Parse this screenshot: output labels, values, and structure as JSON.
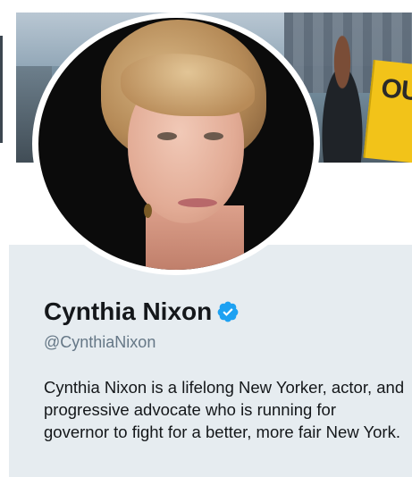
{
  "banner": {
    "sign_text": "OU",
    "icon": "header-photo"
  },
  "avatar": {
    "icon": "profile-photo"
  },
  "profile": {
    "name": "Cynthia Nixon",
    "handle": "@CynthiaNixon",
    "bio": "Cynthia Nixon is a lifelong New Yorker, actor, and progressive advocate who is running for governor to fight for a better, more fair New York.",
    "verified_icon": "verified-badge-icon"
  },
  "colors": {
    "card_background": "#e6ecf0",
    "verified_blue": "#1da1f2",
    "name_text": "#14171a",
    "handle_text": "#657786"
  }
}
